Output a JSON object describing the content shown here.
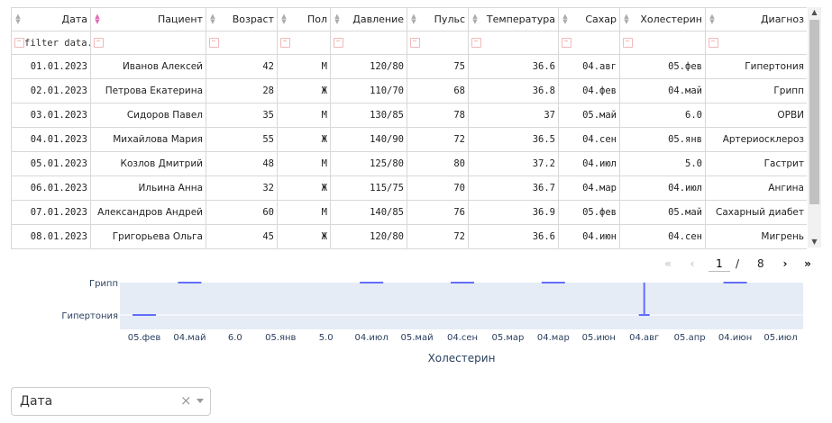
{
  "table": {
    "columns": [
      {
        "label": "Дата",
        "sort_active": false
      },
      {
        "label": "Пациент",
        "sort_active": true
      },
      {
        "label": "Возраст",
        "sort_active": false
      },
      {
        "label": "Пол",
        "sort_active": false
      },
      {
        "label": "Давление",
        "sort_active": false
      },
      {
        "label": "Пульс",
        "sort_active": false
      },
      {
        "label": "Температура",
        "sort_active": false
      },
      {
        "label": "Сахар",
        "sort_active": false
      },
      {
        "label": "Холестерин",
        "sort_active": false
      },
      {
        "label": "Диагноз",
        "sort_active": false
      }
    ],
    "filter_placeholder": "filter data...",
    "rows": [
      [
        "01.01.2023",
        "Иванов Алексей",
        "42",
        "М",
        "120/80",
        "75",
        "36.6",
        "04.авг",
        "05.фев",
        "Гипертония"
      ],
      [
        "02.01.2023",
        "Петрова Екатерина",
        "28",
        "Ж",
        "110/70",
        "68",
        "36.8",
        "04.фев",
        "04.май",
        "Грипп"
      ],
      [
        "03.01.2023",
        "Сидоров Павел",
        "35",
        "М",
        "130/85",
        "78",
        "37",
        "05.май",
        "6.0",
        "ОРВИ"
      ],
      [
        "04.01.2023",
        "Михайлова Мария",
        "55",
        "Ж",
        "140/90",
        "72",
        "36.5",
        "04.сен",
        "05.янв",
        "Артериосклероз"
      ],
      [
        "05.01.2023",
        "Козлов Дмитрий",
        "48",
        "М",
        "125/80",
        "80",
        "37.2",
        "04.июл",
        "5.0",
        "Гастрит"
      ],
      [
        "06.01.2023",
        "Ильина Анна",
        "32",
        "Ж",
        "115/75",
        "70",
        "36.7",
        "04.мар",
        "04.июл",
        "Ангина"
      ],
      [
        "07.01.2023",
        "Александров Андрей",
        "60",
        "М",
        "140/85",
        "76",
        "36.9",
        "05.фев",
        "05.май",
        "Сахарный диабет"
      ],
      [
        "08.01.2023",
        "Григорьева Ольга",
        "45",
        "Ж",
        "120/80",
        "72",
        "36.6",
        "04.июн",
        "04.сен",
        "Мигрень"
      ]
    ]
  },
  "scrollbar": {
    "up_icon": "▲",
    "down_icon": "▼"
  },
  "pagination": {
    "first_icon": "«",
    "prev_icon": "‹",
    "next_icon": "›",
    "last_icon": "»",
    "current_page": "1",
    "separator": "/",
    "total_pages": "8"
  },
  "chart_data": {
    "type": "box",
    "xlabel": "Холестерин",
    "x_categories": [
      "05.фев",
      "04.май",
      "6.0",
      "05.янв",
      "5.0",
      "04.июл",
      "05.май",
      "04.сен",
      "05.мар",
      "04.мар",
      "05.июн",
      "04.авг",
      "05.апр",
      "04.июн",
      "05.июл"
    ],
    "y_categories_visible": [
      "Гипертония",
      "Грипп"
    ],
    "marks": [
      {
        "y": "Гипертония",
        "x": "05.фев",
        "kind": "median"
      },
      {
        "y": "Грипп",
        "x": "04.май",
        "kind": "median"
      },
      {
        "y": "Грипп",
        "x": "04.июл",
        "kind": "median"
      },
      {
        "y": "Грипп",
        "x": "04.сен",
        "kind": "median"
      },
      {
        "y": "Грипп",
        "x": "04.мар",
        "kind": "median"
      },
      {
        "y": "Грипп",
        "x": "04.июн",
        "kind": "median"
      },
      {
        "y": "Гипертония",
        "x": "04.авг",
        "kind": "whisker"
      }
    ],
    "colors": {
      "plot_bg": "#e5ecf6",
      "mark": "#636efa",
      "grid": "#ffffff"
    }
  },
  "dropdown": {
    "value": "Дата",
    "clear_icon": "×",
    "chevron_icon": "chevron-down"
  }
}
